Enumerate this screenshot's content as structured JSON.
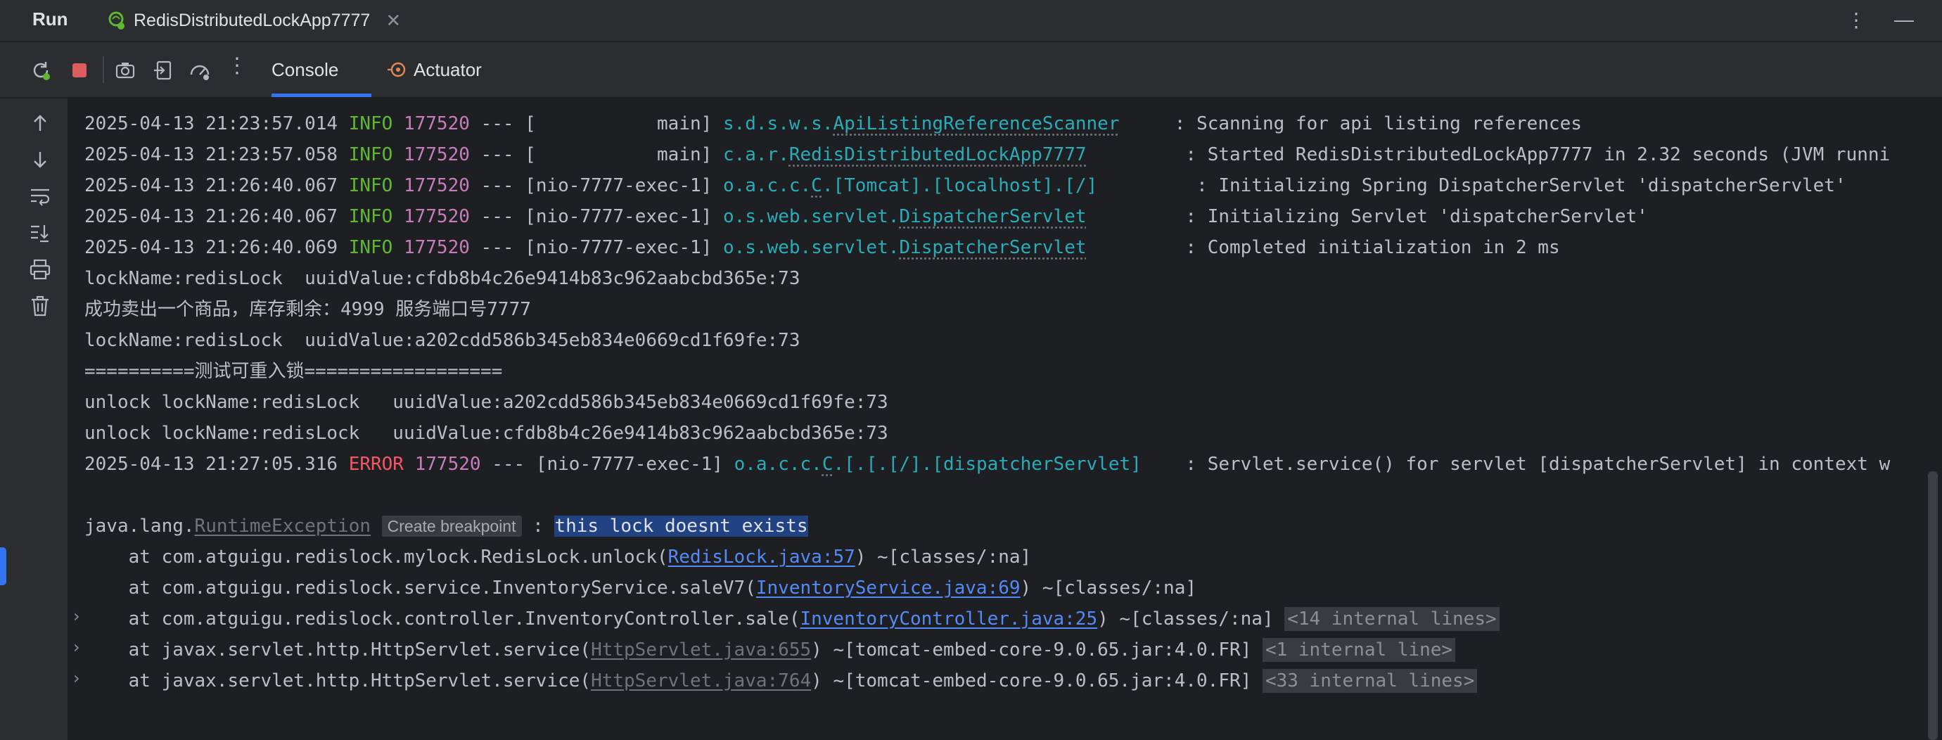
{
  "window": {
    "run_title": "Run",
    "tab_label": "RedisDistributedLockApp7777",
    "close_glyph": "✕",
    "more_glyph": "⋮",
    "minimize_glyph": "—"
  },
  "toolbar": {
    "console_label": "Console",
    "actuator_label": "Actuator",
    "more_glyph": "⋮"
  },
  "console": {
    "log1": {
      "ts": "2025-04-13 21:23:57.014",
      "level": "INFO",
      "pid": "177520",
      "sep": "--- [",
      "thread": "           main]",
      "logger_prefix": "s.d.s.w.s.",
      "logger_class": "ApiListingReferenceScanner",
      "pad": "     ",
      "message": ": Scanning for api listing references"
    },
    "log2": {
      "ts": "2025-04-13 21:23:57.058",
      "level": "INFO",
      "pid": "177520",
      "sep": "--- [",
      "thread": "           main]",
      "logger_prefix": "c.a.r.",
      "logger_class": "RedisDistributedLockApp7777",
      "pad": "         ",
      "message": ": Started RedisDistributedLockApp7777 in 2.32 seconds (JVM runni"
    },
    "log3": {
      "ts": "2025-04-13 21:26:40.067",
      "level": "INFO",
      "pid": "177520",
      "sep": "--- [",
      "thread": "nio-7777-exec-1]",
      "logger_prefix": "o.a.c.c.",
      "logger_class": "C",
      "logger_suffix": ".[Tomcat].[localhost].[/]",
      "pad": "         ",
      "message": ": Initializing Spring DispatcherServlet 'dispatcherServlet'"
    },
    "log4": {
      "ts": "2025-04-13 21:26:40.067",
      "level": "INFO",
      "pid": "177520",
      "sep": "--- [",
      "thread": "nio-7777-exec-1]",
      "logger_prefix": "o.s.web.servlet.",
      "logger_class": "DispatcherServlet",
      "pad": "         ",
      "message": ": Initializing Servlet 'dispatcherServlet'"
    },
    "log5": {
      "ts": "2025-04-13 21:26:40.069",
      "level": "INFO",
      "pid": "177520",
      "sep": "--- [",
      "thread": "nio-7777-exec-1]",
      "logger_prefix": "o.s.web.servlet.",
      "logger_class": "DispatcherServlet",
      "pad": "         ",
      "message": ": Completed initialization in 2 ms"
    },
    "plain1": "lockName:redisLock  uuidValue:cfdb8b4c26e9414b83c962aabcbd365e:73",
    "plain2": "成功卖出一个商品，库存剩余：4999 服务端口号7777",
    "plain3": "lockName:redisLock  uuidValue:a202cdd586b345eb834e0669cd1f69fe:73",
    "plain4": "==========测试可重入锁==================",
    "plain5": "unlock lockName:redisLock   uuidValue:a202cdd586b345eb834e0669cd1f69fe:73",
    "plain6": "unlock lockName:redisLock   uuidValue:cfdb8b4c26e9414b83c962aabcbd365e:73",
    "error_log": {
      "ts": "2025-04-13 21:27:05.316",
      "level": "ERROR",
      "pid": "177520",
      "sep": "--- [",
      "thread": "nio-7777-exec-1]",
      "logger_prefix": "o.a.c.c.",
      "logger_class": "C",
      "logger_suffix": ".[.[.[/].[dispatcherServlet]",
      "pad": "    ",
      "message": ": Servlet.service() for servlet [dispatcherServlet] in context w"
    },
    "exception": {
      "prefix": "java.lang.",
      "class": "RuntimeException",
      "hint": "Create breakpoint",
      "colon": " : ",
      "message": "this lock doesnt exists"
    },
    "stack": [
      {
        "at": "    at com.atguigu.redislock.mylock.RedisLock.unlock(",
        "link": "RedisLock.java:57",
        "tail": ") ~[classes/:na]",
        "internal": ""
      },
      {
        "at": "    at com.atguigu.redislock.service.InventoryService.saleV7(",
        "link": "InventoryService.java:69",
        "tail": ") ~[classes/:na]",
        "internal": ""
      },
      {
        "at": "    at com.atguigu.redislock.controller.InventoryController.sale(",
        "link": "InventoryController.java:25",
        "tail": ") ~[classes/:na]",
        "internal": "<14 internal lines>"
      },
      {
        "at": "    at javax.servlet.http.HttpServlet.service(",
        "link": "HttpServlet.java:655",
        "tail": ") ~[tomcat-embed-core-9.0.65.jar:4.0.FR]",
        "internal": "<1 internal line>"
      },
      {
        "at": "    at javax.servlet.http.HttpServlet.service(",
        "link": "HttpServlet.java:764",
        "tail": ") ~[tomcat-embed-core-9.0.65.jar:4.0.FR]",
        "internal": "<33 internal lines>"
      }
    ],
    "fold_glyph": "›"
  },
  "colors": {
    "accent": "#3574f0",
    "info": "#5fb832",
    "error": "#f75464",
    "pid": "#c77dbb",
    "logger": "#2aacb8",
    "link": "#548af7"
  }
}
